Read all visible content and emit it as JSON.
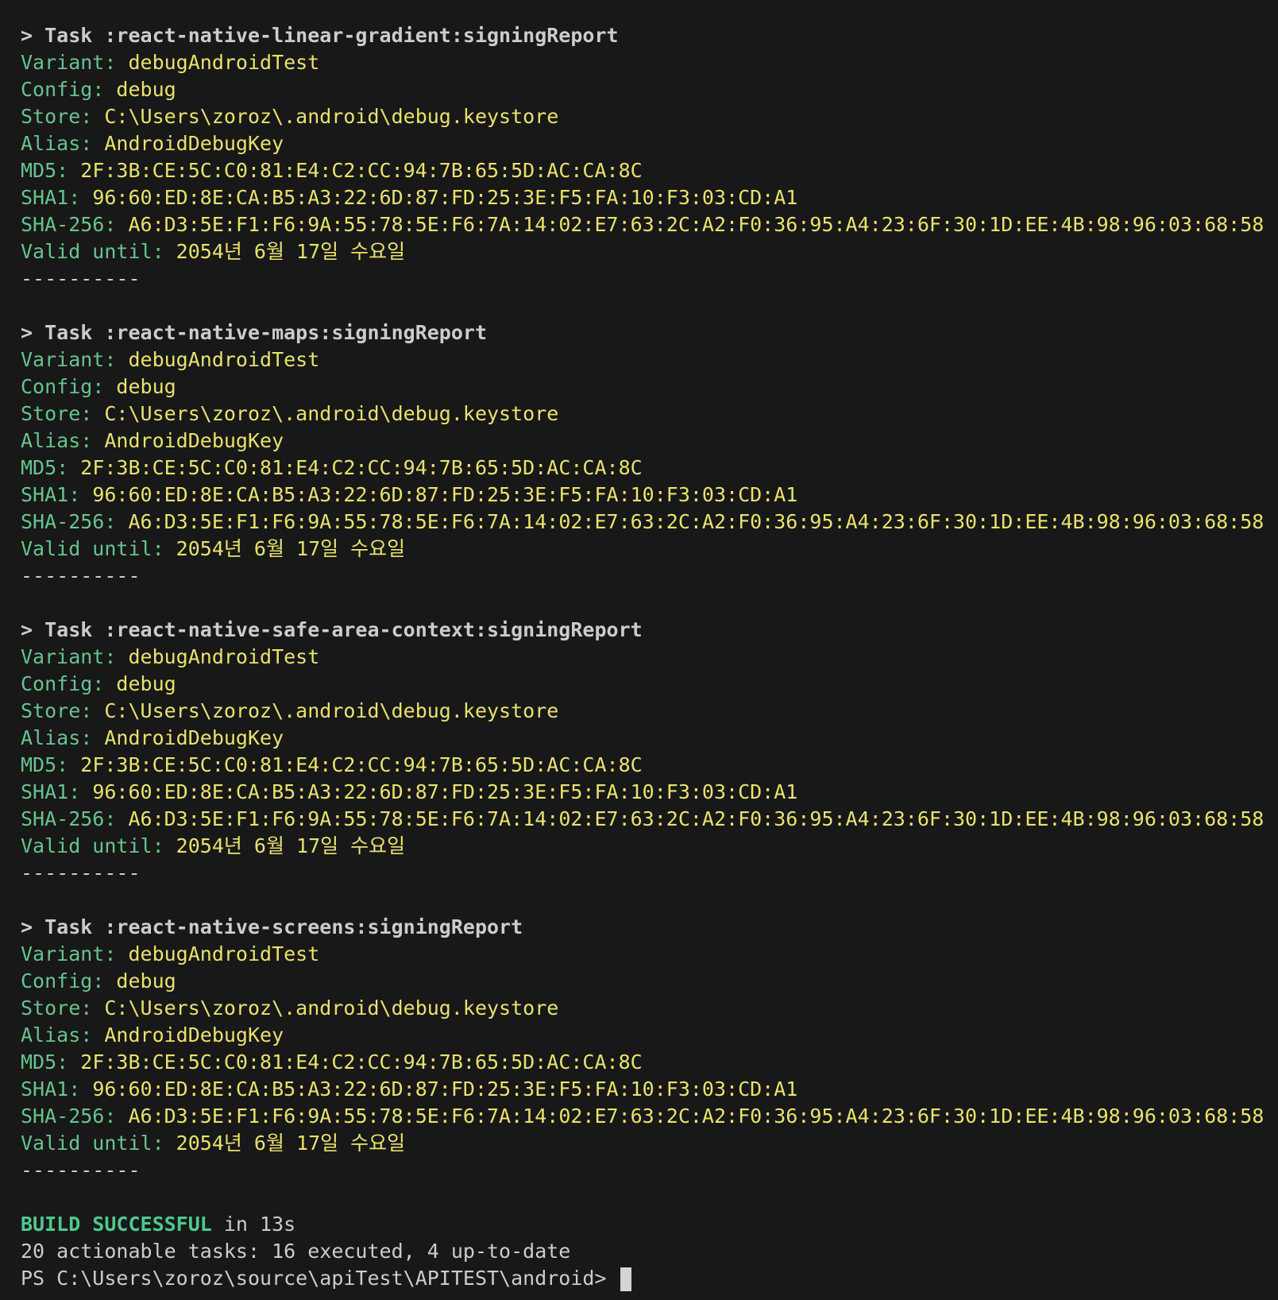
{
  "colors": {
    "background": "#181818",
    "key": "#66c48f",
    "value": "#e9e26b",
    "text": "#cccccc",
    "success": "#4ec98f"
  },
  "tasks": [
    {
      "header": "> Task :react-native-linear-gradient:signingReport",
      "variant": "debugAndroidTest",
      "config": "debug",
      "store": "C:\\Users\\zoroz\\.android\\debug.keystore",
      "alias": "AndroidDebugKey",
      "md5": "2F:3B:CE:5C:C0:81:E4:C2:CC:94:7B:65:5D:AC:CA:8C",
      "sha1": "96:60:ED:8E:CA:B5:A3:22:6D:87:FD:25:3E:F5:FA:10:F3:03:CD:A1",
      "sha256": "A6:D3:5E:F1:F6:9A:55:78:5E:F6:7A:14:02:E7:63:2C:A2:F0:36:95:A4:23:6F:30:1D:EE:4B:98:96:03:68:58",
      "valid_until": "2054년 6월 17일 수요일",
      "separator": "----------"
    },
    {
      "header": "> Task :react-native-maps:signingReport",
      "variant": "debugAndroidTest",
      "config": "debug",
      "store": "C:\\Users\\zoroz\\.android\\debug.keystore",
      "alias": "AndroidDebugKey",
      "md5": "2F:3B:CE:5C:C0:81:E4:C2:CC:94:7B:65:5D:AC:CA:8C",
      "sha1": "96:60:ED:8E:CA:B5:A3:22:6D:87:FD:25:3E:F5:FA:10:F3:03:CD:A1",
      "sha256": "A6:D3:5E:F1:F6:9A:55:78:5E:F6:7A:14:02:E7:63:2C:A2:F0:36:95:A4:23:6F:30:1D:EE:4B:98:96:03:68:58",
      "valid_until": "2054년 6월 17일 수요일",
      "separator": "----------"
    },
    {
      "header": "> Task :react-native-safe-area-context:signingReport",
      "variant": "debugAndroidTest",
      "config": "debug",
      "store": "C:\\Users\\zoroz\\.android\\debug.keystore",
      "alias": "AndroidDebugKey",
      "md5": "2F:3B:CE:5C:C0:81:E4:C2:CC:94:7B:65:5D:AC:CA:8C",
      "sha1": "96:60:ED:8E:CA:B5:A3:22:6D:87:FD:25:3E:F5:FA:10:F3:03:CD:A1",
      "sha256": "A6:D3:5E:F1:F6:9A:55:78:5E:F6:7A:14:02:E7:63:2C:A2:F0:36:95:A4:23:6F:30:1D:EE:4B:98:96:03:68:58",
      "valid_until": "2054년 6월 17일 수요일",
      "separator": "----------"
    },
    {
      "header": "> Task :react-native-screens:signingReport",
      "variant": "debugAndroidTest",
      "config": "debug",
      "store": "C:\\Users\\zoroz\\.android\\debug.keystore",
      "alias": "AndroidDebugKey",
      "md5": "2F:3B:CE:5C:C0:81:E4:C2:CC:94:7B:65:5D:AC:CA:8C",
      "sha1": "96:60:ED:8E:CA:B5:A3:22:6D:87:FD:25:3E:F5:FA:10:F3:03:CD:A1",
      "sha256": "A6:D3:5E:F1:F6:9A:55:78:5E:F6:7A:14:02:E7:63:2C:A2:F0:36:95:A4:23:6F:30:1D:EE:4B:98:96:03:68:58",
      "valid_until": "2054년 6월 17일 수요일",
      "separator": "----------"
    }
  ],
  "labels": {
    "variant": "Variant: ",
    "config": "Config: ",
    "store": "Store: ",
    "alias": "Alias: ",
    "md5": "MD5: ",
    "sha1": "SHA1: ",
    "sha256": "SHA-256: ",
    "valid_until": "Valid until: "
  },
  "footer": {
    "build_status": "BUILD SUCCESSFUL",
    "build_time": " in 13s",
    "summary": "20 actionable tasks: 16 executed, 4 up-to-date",
    "prompt": "PS C:\\Users\\zoroz\\source\\apiTest\\APITEST\\android> "
  }
}
